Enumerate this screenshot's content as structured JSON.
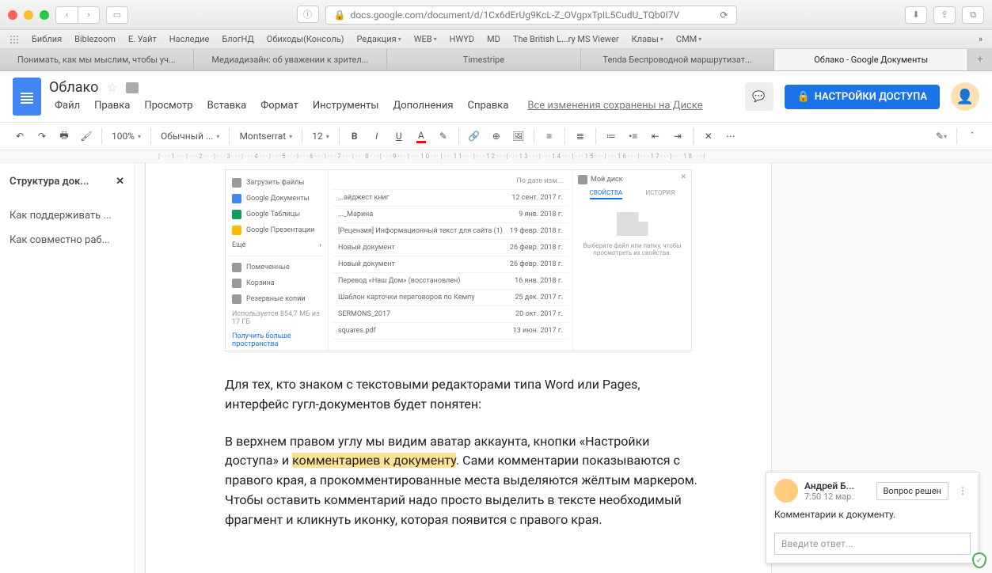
{
  "browser": {
    "url": "docs.google.com/document/d/1Cx6dErUg9KcL-Z_OVgpxTpIL5CudU_TQb0I7V",
    "bookmarks": [
      "Библия",
      "Biblezoom",
      "Е. Уайт",
      "Наследие",
      "БлогНД",
      "Обиходы(Консоль)",
      "Редакция",
      "WEB",
      "HWYD",
      "MD",
      "The British L...ry MS Viewer",
      "Клавы",
      "CMM"
    ],
    "tabs": [
      {
        "label": "Понимать, как мы мыслим, чтобы уч...",
        "active": false
      },
      {
        "label": "Медиадизайн: об уважении к зрител...",
        "active": false
      },
      {
        "label": "Timestripe",
        "active": false
      },
      {
        "label": "Tenda Беспроводной маршрутизат...",
        "active": false
      },
      {
        "label": "Облако - Google Документы",
        "active": true
      }
    ]
  },
  "doc": {
    "title": "Облако",
    "menus": [
      "Файл",
      "Правка",
      "Просмотр",
      "Вставка",
      "Формат",
      "Инструменты",
      "Дополнения",
      "Справка"
    ],
    "saved": "Все изменения сохранены на Диске",
    "share": "НАСТРОЙКИ ДОСТУПА"
  },
  "toolbar": {
    "zoom": "100%",
    "style": "Обычный ...",
    "font": "Montserrat",
    "size": "12"
  },
  "outline": {
    "title": "Структура док...",
    "items": [
      "Как поддерживать ...",
      "Как совместно раб..."
    ]
  },
  "drive": {
    "panel_title": "Мой диск",
    "left": [
      {
        "label": "Загрузить файлы"
      },
      {
        "label": "Google Документы"
      },
      {
        "label": "Google Таблицы"
      },
      {
        "label": "Google Презентации"
      },
      {
        "label": "Ещё"
      },
      {
        "label": "Помеченные"
      },
      {
        "label": "Корзина"
      },
      {
        "label": "Резервные копии"
      },
      {
        "label": "Используется 854,7 МБ из 17 ГБ"
      },
      {
        "label": "Получить больше пространства"
      }
    ],
    "rows": [
      {
        "name": "...айджест книг",
        "date": "12 сент. 2017 г."
      },
      {
        "name": "..._Марина",
        "date": "9 янв. 2018 г."
      },
      {
        "name": "[Рецензия] Информационный текст для сайта (1)",
        "date": "19 февр. 2018 г."
      },
      {
        "name": "Новый документ",
        "date": "26 февр. 2018 г."
      },
      {
        "name": "Новый документ",
        "date": "26 февр. 2018 г."
      },
      {
        "name": "Перевод «Наш Дом» (восстановлен)",
        "date": "16 янв. 2018 г."
      },
      {
        "name": "Шаблон карточки переговоров по Кемпу",
        "date": "25 дек. 2017 г."
      },
      {
        "name": "SERMONS_2017",
        "date": "20 окт. 2017 г."
      },
      {
        "name": "squares.pdf",
        "date": "13 июн. 2017 г."
      }
    ],
    "tabs": {
      "props": "СВОЙСТВА",
      "hist": "ИСТОРИЯ"
    },
    "empty": "Выберите файл или папку, чтобы просмотреть их свойства.",
    "date_header": "По дате изм..."
  },
  "body": {
    "p1": "Для тех, кто знаком с текстовыми редакторами типа Word или Pages, интерфейс гугл-документов будет понятен:",
    "p2a": "В верхнем правом углу мы видим аватар аккаунта, кнопки «Настройки доступа» и ",
    "p2h": "комментариев к документу",
    "p2b": ". Сами комментарии показываются с правого края, а прокомментированные места выделяются жёлтым маркером. Чтобы оставить комментарий надо просто выделить в тексте необходимый фрагмент и кликнуть иконку, которая появится с правого края."
  },
  "comment": {
    "name": "Андрей Б...",
    "time": "7:50 12 мар.",
    "resolve": "Вопрос решен",
    "text": "Комментарии к документу.",
    "reply_placeholder": "Введите ответ..."
  }
}
